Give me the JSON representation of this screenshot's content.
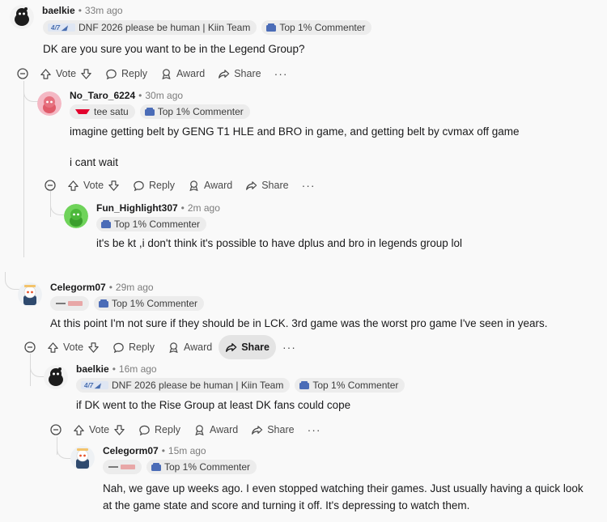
{
  "comments": [
    {
      "username": "baelkie",
      "time": "33m ago",
      "flairs": [
        "DNF 2026 please be human | Kiin Team",
        "Top 1% Commenter"
      ],
      "body": [
        "DK are you sure you want to be in the Legend Group?"
      ]
    },
    {
      "username": "No_Taro_6224",
      "time": "30m ago",
      "flairs": [
        "tee satu",
        "Top 1% Commenter"
      ],
      "body": [
        "imagine getting belt by GENG T1 HLE and BRO in game, and getting belt by cvmax off game",
        "i cant wait"
      ]
    },
    {
      "username": "Fun_Highlight307",
      "time": "2m ago",
      "flairs": [
        "Top 1% Commenter"
      ],
      "body": [
        "it's be kt ,i don't think it's possible to have dplus and bro in legends group lol"
      ]
    },
    {
      "username": "Celegorm07",
      "time": "29m ago",
      "flairs": [
        "Top 1% Commenter"
      ],
      "body": [
        "At this point I'm not sure if they should be in LCK. 3rd game was the worst pro game I've seen in years."
      ]
    },
    {
      "username": "baelkie",
      "time": "16m ago",
      "flairs": [
        "DNF 2026 please be human | Kiin Team",
        "Top 1% Commenter"
      ],
      "body": [
        "if DK went to the Rise Group at least DK fans could cope"
      ]
    },
    {
      "username": "Celegorm07",
      "time": "15m ago",
      "flairs": [
        "Top 1% Commenter"
      ],
      "body": [
        "Nah, we gave up weeks ago. I even stopped watching their games. Just usually having a quick look at the game state and score and turning it off. It's depressing to watch them."
      ]
    }
  ],
  "actions": {
    "vote": "Vote",
    "reply": "Reply",
    "award": "Award",
    "share": "Share",
    "more": "···"
  },
  "colors": {
    "background": "#f9f9f9",
    "flair_bg": "#ececec",
    "upvote_accent": "#ff4500",
    "thread_line": "#d9d9d9"
  },
  "icons": [
    "snoo-avatar-icon",
    "collapse-icon",
    "upvote-icon",
    "downvote-icon",
    "reply-icon",
    "award-icon",
    "share-icon",
    "flair-badge-icon"
  ]
}
